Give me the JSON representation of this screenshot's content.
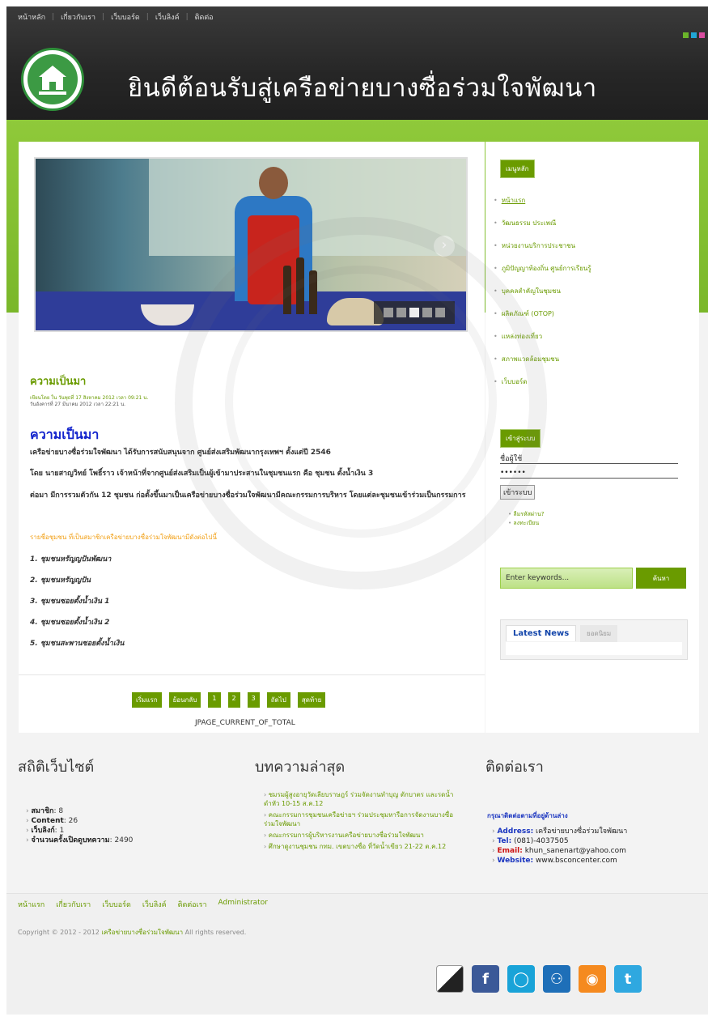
{
  "topnav": [
    "หน้าหลัก",
    "เกี่ยวกับเรา",
    "เว็บบอร์ด",
    "เว็บลิงค์",
    "ติดต่อ"
  ],
  "site_title": "ยินดีต้อนรับสู่เครือข่ายบางซื่อร่วมใจพัฒนา",
  "colors": {
    "accent": "#6a9b00",
    "green_band": "#8fc93a",
    "header_dark": "#2a2a2a",
    "link_blue": "#1122cc"
  },
  "article": {
    "title": "ความเป็นมา",
    "meta_1": "เขียนโดย ใน วันพุธที่ 17 สิงหาคม 2012 เวลา 09:21 น.",
    "meta_2": "วันอังคารที่ 27 มีนาคม 2012 เวลา 22:21 น.",
    "subtitle": "ความเป็นมา",
    "p1": "เครือข่ายบางซื่อร่วมใจพัฒนา ได้รับการสนับสนุนจาก ศูนย์ส่งเสริมพัฒนากรุงเทพฯ ตั้งแต่ปี   2546",
    "p2": "โดย นายสาญวิทย์   โพธิ์ราว เจ้าหน้าที่จากศูนย์ส่งเสริมเป็นผู้เข้ามาประสานในชุมชนแรก คือ ชุมชน ตั้งน้ำเงิน 3",
    "p3": "ต่อมา  มีการรวมตัวกัน  12  ชุมชน ก่อตั้งขึ้นมาเป็นเครือข่ายบางซื่อร่วมใจพัฒนามีคณะกรรมการบริหาร โดยแต่ละชุมชนเข้าร่วมเป็นกรรมการ",
    "orange_line": "รายชื่อชุมชน ที่เป็นสมาชิกเครือข่ายบางซื่อร่วมใจพัฒนามีดังต่อไปนี้",
    "list": [
      "1. ชุมชนหรัญญปันพัฒนา",
      "2. ชุมชนหรัญญปัน",
      "3. ชุมชนซอยตั้งน้ำเงิน 1",
      "4. ชุมชนซอยตั้งน้ำเงิน 2",
      "5. ชุมชนสะพานซอยตั้งน้ำเงิน"
    ]
  },
  "pager": {
    "buttons": [
      "เริ่มแรก",
      "ย้อนกลับ",
      "1",
      "2",
      "3",
      "ถัดไป",
      "สุดท้าย"
    ],
    "status": "JPAGE_CURRENT_OF_TOTAL"
  },
  "sidebar": {
    "menu_title": "เมนูหลัก",
    "menu": [
      "หน้าแรก",
      "วัฒนธรรม ประเพณี",
      "หน่วยงานบริการประชาชน",
      "ภูมิปัญญาท้องถิ่น ศูนย์การเรียนรู้",
      "บุคคลสำคัญในชุมชน",
      "ผลิตภัณฑ์ (OTOP)",
      "แหล่งท่องเที่ยว",
      "สภาพแวดล้อมชุมชน",
      "เว็บบอร์ด"
    ],
    "login_title": "เข้าสู่ระบบ",
    "username": "ชื่อผู้ใช้",
    "password": "••••••",
    "login_button": "เข้าระบบ",
    "login_links": [
      "ลืมรหัสผ่าน?",
      "ลงทะเบียน"
    ],
    "search_placeholder": "Enter keywords...",
    "search_button": "ค้นหา",
    "tab_active": "Latest News",
    "tab_idle": "ยอดนิยม"
  },
  "footer": {
    "stats_title": "สถิติเว็บไซต์",
    "stats": [
      {
        "label": "สมาชิก",
        "value": ": 8"
      },
      {
        "label": "Content",
        "value": ": 26"
      },
      {
        "label": "เว็บลิงก์",
        "value": ": 1"
      },
      {
        "label": "จำนวนครั้งเปิดดูบทความ",
        "value": ": 2490"
      }
    ],
    "articles_title": "บทความล่าสุด",
    "articles": [
      "ชมรมผู้สูงอายุวัดเลียบราษฎร์ ร่วมจัดงานทำบุญ ตักบาตร และรดน้ำดำหัว 10-15 ส.ค.12",
      "คณะกรรมการชุมชนเครือข่ายฯ ร่วมประชุมหารือการจัดงานบางซื่อร่วมใจพัฒนา",
      "คณะกรรมการผู้บริหารงานเครือข่ายบางซื่อร่วมใจพัฒนา",
      "ศึกษาดูงานชุมชน กทม. เขตบางซื่อ ที่วัดน้ำเขียว 21-22 ต.ค.12"
    ],
    "contact_title": "ติดต่อเรา",
    "contact_lead": "กรุณาติดต่อตามที่อยู่ด้านล่าง",
    "contact": [
      {
        "label": "Address:",
        "value": " เครือข่ายบางซื่อร่วมใจพัฒนา"
      },
      {
        "label": "Tel:",
        "value": " (081)-4037505"
      },
      {
        "label": "Email:",
        "value": " khun_sanenart@yahoo.com"
      },
      {
        "label": "Website:",
        "value": " www.bsconcenter.com"
      }
    ],
    "bottom_nav": [
      "หน้าแรก",
      "เกี่ยวกับเรา",
      "เว็บบอร์ด",
      "เว็บลิงค์",
      "ติดต่อเรา",
      "Administrator"
    ],
    "copyright_prefix": "Copyright © 2012 - 2012",
    "copyright_link": "เครือข่ายบางซื่อร่วมใจพัฒนา",
    "copyright_suffix": "All rights reserved.",
    "social": [
      "delicious-icon",
      "facebook-icon",
      "chat-icon",
      "myspace-icon",
      "rss-icon",
      "twitter-icon"
    ]
  }
}
